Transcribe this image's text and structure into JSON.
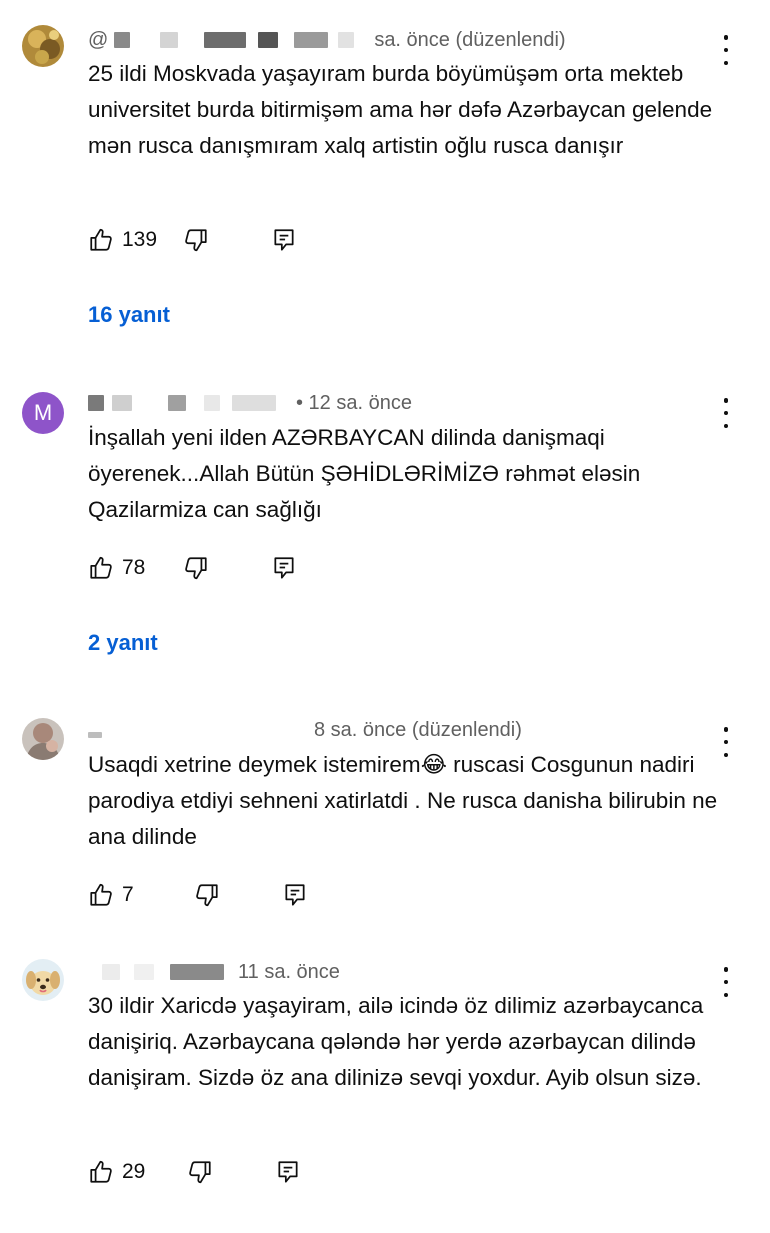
{
  "comments": [
    {
      "author": "@",
      "meta": "sa. önce (düzenlendi)",
      "text": "25 ildi Moskvada yaşayıram burda böyümüşəm orta mekteb universitet burda bitirmişəm ama hər dəfə Azərbaycan gelende mən rusca danışmıram xalq artistin oğlu rusca danışır",
      "likes": "139",
      "replies": "16 yanıt"
    },
    {
      "avatar_letter": "M",
      "meta": "• 12 sa. önce",
      "text": "İnşallah yeni ilden AZƏRBAYCAN dilinda danişmaqi öyerenek...Allah Bütün ŞƏHİDLƏRİMİZƏ rəhmət eləsin Qazilarmiza can sağlığı",
      "likes": "78",
      "replies": "2 yanıt"
    },
    {
      "meta": "8 sa. önce (düzenlendi)",
      "text": "Usaqdi xetrine deymek istemirem😂 ruscasi Cosgunun nadiri parodiya etdiyi sehneni xatirlatdi . Ne rusca danisha bilirubin ne ana dilinde",
      "likes": "7"
    },
    {
      "meta": "11 sa. önce",
      "text": "30 ildir Xaricdə yaşayiram, ailə icində öz dilimiz azərbaycanca danişiriq. Azərbaycana qələndə hər yerdə azərbaycan dilində danişiram. Sizdə öz ana dilinizə sevqi yoxdur. Ayib olsun sizə.",
      "likes": "29"
    }
  ],
  "colors": {
    "text": "#0f0f0f",
    "meta": "#606060",
    "link": "#065fd4",
    "avatar_m": "#8e54c9"
  },
  "icons": [
    "thumbs-up-icon",
    "thumbs-down-icon",
    "reply-icon",
    "more-vert-icon"
  ]
}
